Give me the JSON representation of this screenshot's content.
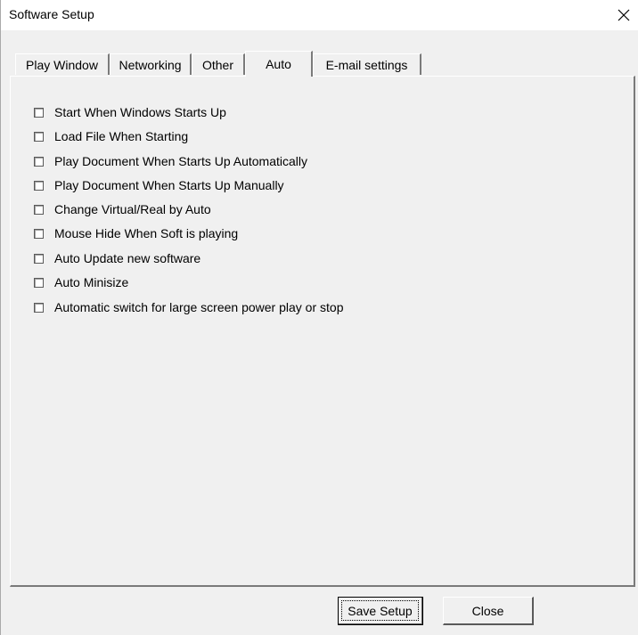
{
  "window": {
    "title": "Software Setup",
    "close_icon": "close-icon"
  },
  "tabs": [
    {
      "label": "Play Window",
      "active": false
    },
    {
      "label": "Networking",
      "active": false
    },
    {
      "label": "Other",
      "active": false
    },
    {
      "label": "Auto",
      "active": true
    },
    {
      "label": "E-mail settings",
      "active": false
    }
  ],
  "options": [
    {
      "label": "Start When Windows Starts Up",
      "checked": false
    },
    {
      "label": "Load File When Starting",
      "checked": false
    },
    {
      "label": "Play Document When Starts Up Automatically",
      "checked": false
    },
    {
      "label": "Play Document When Starts Up Manually",
      "checked": false
    },
    {
      "label": "Change Virtual/Real by Auto",
      "checked": false
    },
    {
      "label": "Mouse Hide When Soft is playing",
      "checked": false
    },
    {
      "label": "Auto Update new software",
      "checked": false
    },
    {
      "label": "Auto Minisize",
      "checked": false
    },
    {
      "label": "Automatic switch for large screen power play or stop",
      "checked": false
    }
  ],
  "buttons": {
    "save_label": "Save Setup",
    "close_label": "Close"
  }
}
